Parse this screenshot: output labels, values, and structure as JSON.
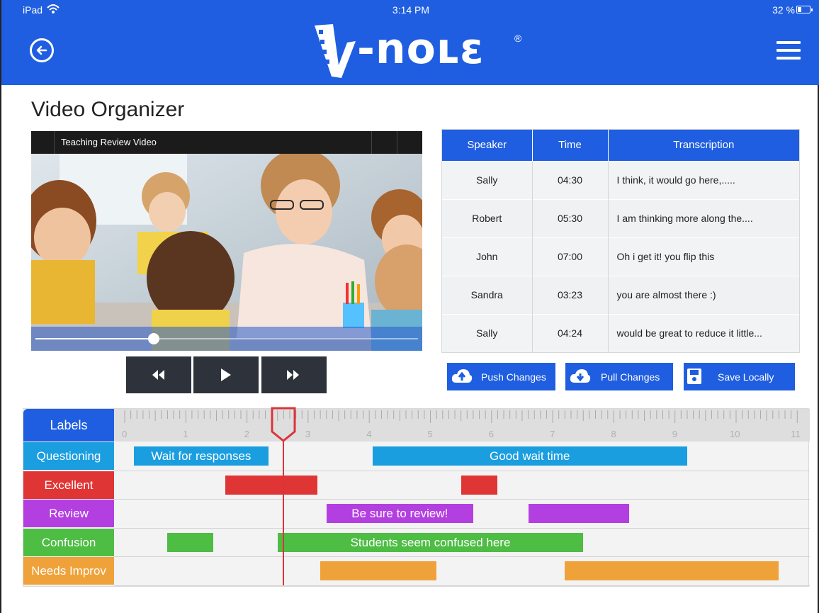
{
  "status_bar": {
    "device": "iPad",
    "time": "3:14 PM",
    "battery": "32 %",
    "battery_level": 0.32
  },
  "nav": {
    "logo": "V-noʟɛ",
    "brand_color": "#1f5ee0"
  },
  "page": {
    "title": "Video Organizer"
  },
  "video": {
    "title": "Teaching Review Video",
    "progress": 0.31
  },
  "controls": {
    "rewind": "rewind-icon",
    "play": "play-icon",
    "forward": "fast-forward-icon"
  },
  "transcript": {
    "headers": [
      "Speaker",
      "Time",
      "Transcription"
    ],
    "rows": [
      [
        "Sally",
        "04:30",
        "I think, it would go here,....."
      ],
      [
        "Robert",
        "05:30",
        "I am thinking more along the...."
      ],
      [
        "John",
        "07:00",
        "Oh i get it! you flip this"
      ],
      [
        "Sandra",
        "03:23",
        "you are almost there :)"
      ],
      [
        "Sally",
        "04:24",
        "would be great to reduce it little..."
      ]
    ]
  },
  "actions": {
    "push": "Push Changes",
    "pull": "Pull Changes",
    "save": "Save Locally"
  },
  "timeline": {
    "header": "Labels",
    "ticks": [
      "0",
      "1",
      "2",
      "3",
      "4",
      "5",
      "6",
      "7",
      "8",
      "9",
      "10",
      "11"
    ],
    "playhead": 2.6,
    "rows": [
      {
        "label": "Questioning",
        "color": "#1a9ee0",
        "segments": [
          {
            "start": 0.15,
            "end": 2.35,
            "text": "Wait for responses"
          },
          {
            "start": 4.05,
            "end": 9.2,
            "text": "Good wait time"
          }
        ]
      },
      {
        "label": "Excellent",
        "color": "#e03535",
        "segments": [
          {
            "start": 1.65,
            "end": 3.15,
            "text": ""
          },
          {
            "start": 5.5,
            "end": 6.1,
            "text": ""
          }
        ]
      },
      {
        "label": "Review",
        "color": "#b43fe0",
        "segments": [
          {
            "start": 3.3,
            "end": 5.7,
            "text": "Be sure to review!"
          },
          {
            "start": 6.6,
            "end": 8.25,
            "text": ""
          }
        ]
      },
      {
        "label": "Confusion",
        "color": "#4dbd44",
        "segments": [
          {
            "start": 0.7,
            "end": 1.45,
            "text": ""
          },
          {
            "start": 2.5,
            "end": 7.5,
            "text": "Students seem confused here"
          }
        ]
      },
      {
        "label": "Needs Improv",
        "color": "#f0a23a",
        "segments": [
          {
            "start": 3.2,
            "end": 5.1,
            "text": ""
          },
          {
            "start": 7.2,
            "end": 10.7,
            "text": ""
          }
        ]
      }
    ]
  }
}
